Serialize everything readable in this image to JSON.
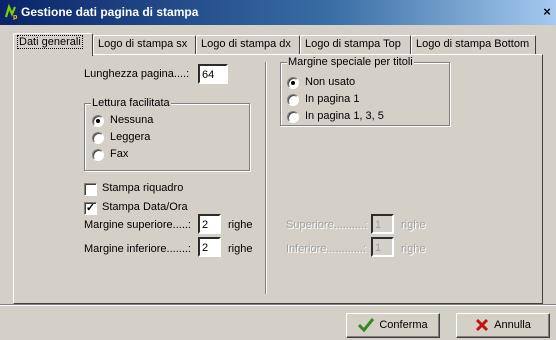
{
  "window": {
    "title": "Gestione dati pagina di stampa",
    "close_glyph": "×"
  },
  "tabs": [
    {
      "label": "Dati generali",
      "active": true
    },
    {
      "label": "Logo di stampa sx",
      "active": false
    },
    {
      "label": "Logo di stampa dx",
      "active": false
    },
    {
      "label": "Logo di stampa Top",
      "active": false
    },
    {
      "label": "Logo di stampa Bottom",
      "active": false
    }
  ],
  "general": {
    "page_length_label": "Lunghezza pagina....:",
    "page_length_value": "64",
    "reading_group": {
      "legend": "Lettura facilitata",
      "options": [
        {
          "label": "Nessuna",
          "selected": true
        },
        {
          "label": "Leggera",
          "selected": false
        },
        {
          "label": "Fax",
          "selected": false
        }
      ]
    },
    "print_frame": {
      "label": "Stampa riquadro",
      "checked": false
    },
    "print_datetime": {
      "label": "Stampa Data/Ora",
      "checked": true
    },
    "top_margin": {
      "label": "Margine superiore.....:",
      "value": "2",
      "unit": "righe"
    },
    "bottom_margin": {
      "label": "Margine inferiore.......:",
      "value": "2",
      "unit": "righe"
    }
  },
  "titles_margin": {
    "group": {
      "legend": "Margine speciale per titoli",
      "options": [
        {
          "label": "Non usato",
          "selected": true
        },
        {
          "label": "In pagina 1",
          "selected": false
        },
        {
          "label": "In pagina 1, 3, 5",
          "selected": false
        }
      ]
    },
    "superiore": {
      "label": "Superiore..........:",
      "value": "1",
      "unit": "righe"
    },
    "inferiore": {
      "label": "Inferiore............:",
      "value": "1",
      "unit": "righe"
    }
  },
  "buttons": {
    "confirm": {
      "label": "Conferma",
      "icon": "checkmark-icon",
      "color": "#2e8b1e"
    },
    "cancel": {
      "label": "Annulla",
      "icon": "x-icon",
      "color": "#c81010"
    }
  },
  "colors": {
    "titlebar_start": "#0a246a",
    "titlebar_end": "#a6caf0",
    "face": "#d4d0c8"
  }
}
